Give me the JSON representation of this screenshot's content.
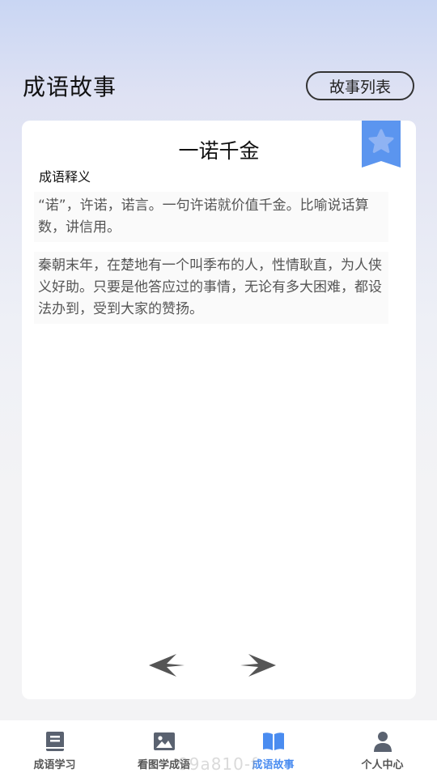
{
  "header": {
    "title": "成语故事",
    "list_button": "故事列表"
  },
  "card": {
    "idiom": "一诺千金",
    "section_label": "成语释义",
    "meaning": "“诺”，许诺，诺言。一句许诺就价值千金。比喻说话算数，讲信用。",
    "story": "秦朝末年，在楚地有一个叫季布的人，性情耿直，为人侠义好助。只要是他答应过的事情，无论有多大困难，都设法办到，受到大家的赞扬。",
    "bookmark_icon": "star-icon"
  },
  "tabs": [
    {
      "label": "成语学习",
      "icon": "book-icon"
    },
    {
      "label": "看图学成语",
      "icon": "image-icon"
    },
    {
      "label": "成语故事",
      "icon": "open-book-icon",
      "active": true
    },
    {
      "label": "个人中心",
      "icon": "user-icon"
    }
  ],
  "watermark": "99a810-f",
  "colors": {
    "accent": "#4a8cf0",
    "bookmark": "#5b95ef"
  }
}
